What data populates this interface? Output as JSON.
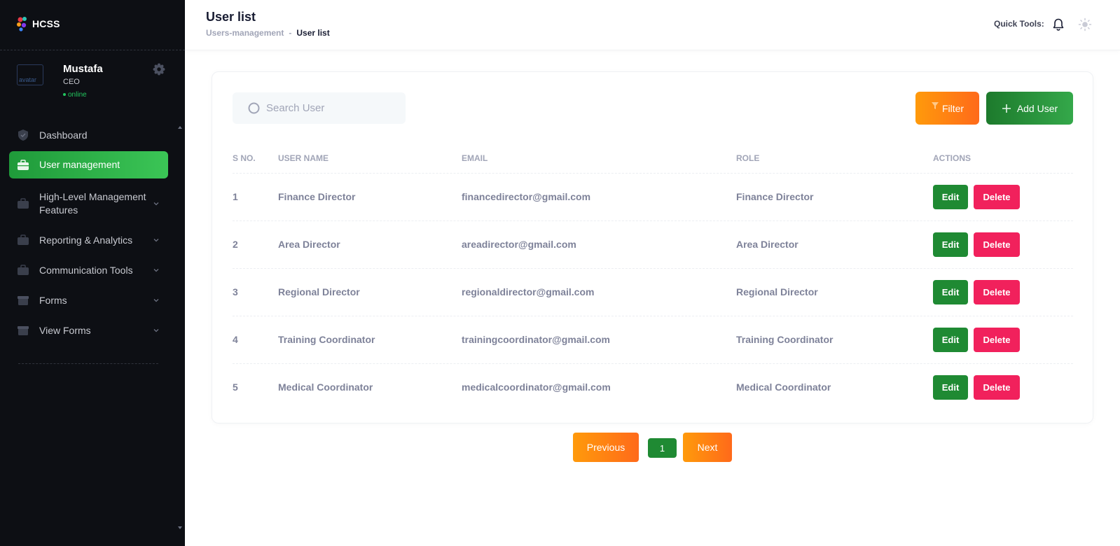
{
  "app": {
    "logo_text": "HCSS"
  },
  "profile": {
    "avatar_alt": "avatar",
    "name": "Mustafa",
    "role": "CEO",
    "status": "online"
  },
  "sidebar": {
    "items": [
      {
        "label": "Dashboard",
        "icon": "shield-icon",
        "active": false,
        "has_chevron": false
      },
      {
        "label": "User management",
        "icon": "briefcase-icon",
        "active": true,
        "has_chevron": false
      },
      {
        "label": "High-Level Management Features",
        "icon": "briefcase-icon",
        "active": false,
        "has_chevron": true
      },
      {
        "label": "Reporting & Analytics",
        "icon": "briefcase-icon",
        "active": false,
        "has_chevron": true
      },
      {
        "label": "Communication Tools",
        "icon": "briefcase-icon",
        "active": false,
        "has_chevron": true
      },
      {
        "label": "Forms",
        "icon": "box-icon",
        "active": false,
        "has_chevron": true
      },
      {
        "label": "View Forms",
        "icon": "box-icon",
        "active": false,
        "has_chevron": true
      }
    ]
  },
  "header": {
    "title": "User list",
    "breadcrumb": {
      "parent": "Users-management",
      "separator": "-",
      "current": "User list"
    },
    "quick_tools_label": "Quick Tools:"
  },
  "toolbar": {
    "search_placeholder": "Search User",
    "filter_label": "Filter",
    "add_user_label": "Add User"
  },
  "table": {
    "columns": [
      "S NO.",
      "USER NAME",
      "EMAIL",
      "ROLE",
      "ACTIONS"
    ],
    "rows": [
      {
        "sno": "1",
        "name": "Finance Director",
        "email": "financedirector@gmail.com",
        "role": "Finance Director"
      },
      {
        "sno": "2",
        "name": "Area Director",
        "email": "areadirector@gmail.com",
        "role": "Area Director"
      },
      {
        "sno": "3",
        "name": "Regional Director",
        "email": "regionaldirector@gmail.com",
        "role": "Regional Director"
      },
      {
        "sno": "4",
        "name": "Training Coordinator",
        "email": "trainingcoordinator@gmail.com",
        "role": "Training Coordinator"
      },
      {
        "sno": "5",
        "name": "Medical Coordinator",
        "email": "medicalcoordinator@gmail.com",
        "role": "Medical Coordinator"
      }
    ],
    "edit_label": "Edit",
    "delete_label": "Delete"
  },
  "pagination": {
    "previous_label": "Previous",
    "current_page": "1",
    "next_label": "Next"
  },
  "colors": {
    "sidebar_bg": "#0d0f14",
    "active_green": "#34a84a",
    "edit_green": "#1f8a33",
    "delete_pink": "#f1215c",
    "orange": "#ff8a12"
  }
}
